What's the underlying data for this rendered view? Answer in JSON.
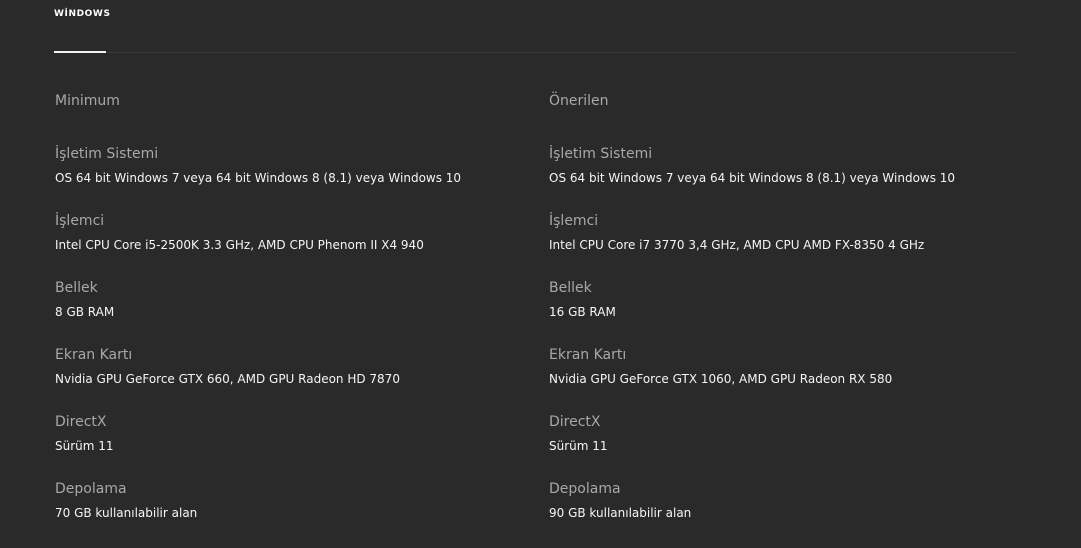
{
  "tabs": {
    "active_label": "WİNDOWS"
  },
  "minimum": {
    "title": "Minimum",
    "specs": [
      {
        "label": "İşletim Sistemi",
        "value": "OS 64 bit Windows 7 veya 64 bit Windows 8 (8.1) veya Windows 10"
      },
      {
        "label": "İşlemci",
        "value": "Intel CPU Core i5-2500K 3.3 GHz, AMD CPU Phenom II X4 940"
      },
      {
        "label": "Bellek",
        "value": "8 GB RAM"
      },
      {
        "label": "Ekran Kartı",
        "value": "Nvidia GPU GeForce GTX 660, AMD GPU Radeon HD 7870"
      },
      {
        "label": "DirectX",
        "value": "Sürüm 11"
      },
      {
        "label": "Depolama",
        "value": "70 GB kullanılabilir alan"
      }
    ]
  },
  "recommended": {
    "title": "Önerilen",
    "specs": [
      {
        "label": "İşletim Sistemi",
        "value": "OS 64 bit Windows 7 veya 64 bit Windows 8 (8.1) veya Windows 10"
      },
      {
        "label": "İşlemci",
        "value": "Intel CPU Core i7 3770 3,4 GHz, AMD CPU AMD FX-8350 4 GHz"
      },
      {
        "label": "Bellek",
        "value": "16 GB RAM"
      },
      {
        "label": "Ekran Kartı",
        "value": "Nvidia GPU GeForce GTX 1060, AMD GPU Radeon RX 580"
      },
      {
        "label": "DirectX",
        "value": "Sürüm 11"
      },
      {
        "label": "Depolama",
        "value": "90 GB kullanılabilir alan"
      }
    ]
  }
}
